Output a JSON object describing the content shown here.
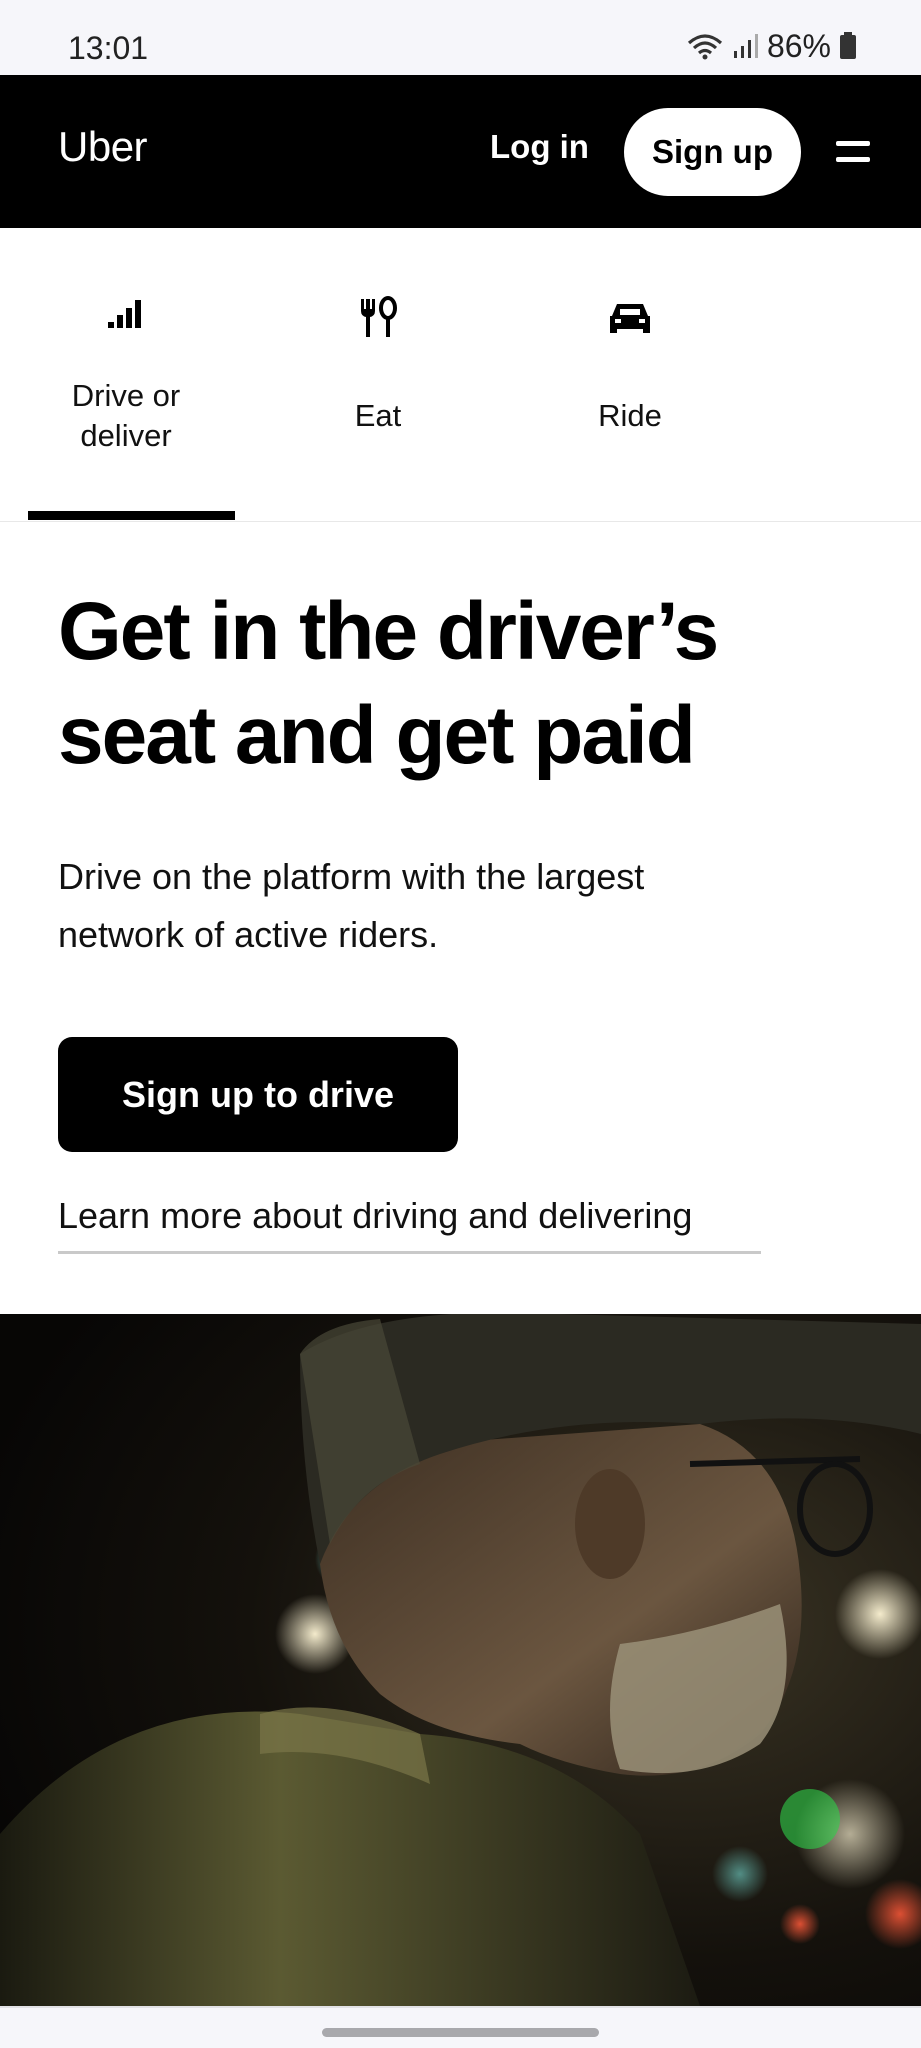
{
  "status_bar": {
    "time": "13:01",
    "battery": "86%",
    "icons": [
      "wifi-icon",
      "signal-icon",
      "battery-icon"
    ]
  },
  "nav": {
    "logo": "Uber",
    "login": "Log in",
    "signup": "Sign up",
    "menu_icon": "menu-icon"
  },
  "tabs": [
    {
      "label": "Drive or deliver",
      "icon": "signal-bars-icon",
      "selected": true
    },
    {
      "label": "Eat",
      "icon": "fork-spoon-icon",
      "selected": false
    },
    {
      "label": "Ride",
      "icon": "car-icon",
      "selected": false
    }
  ],
  "hero": {
    "title": "Get in the driver’s seat and get paid",
    "subtitle": "Drive on the platform with the largest network of active riders.",
    "cta": "Sign up to drive",
    "learn_more": "Learn more about driving and delivering"
  },
  "colors": {
    "nav_background": "#000000",
    "page_background": "#ffffff",
    "cta_background": "#000000",
    "system_bar": "#f6f6fa"
  }
}
